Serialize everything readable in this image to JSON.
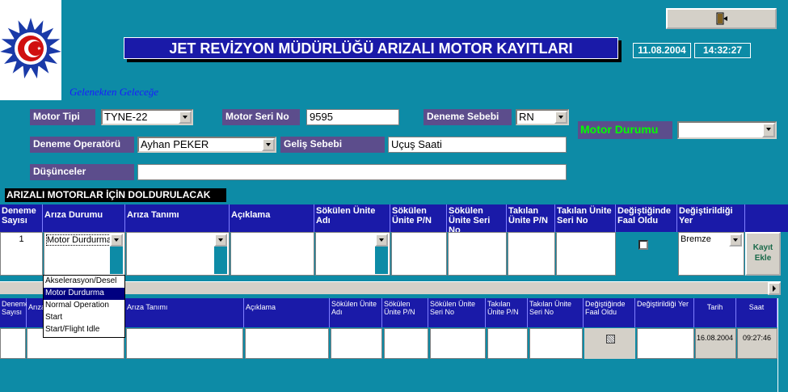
{
  "title": "JET REVİZYON MÜDÜRLÜĞÜ ARIZALI MOTOR KAYITLARI",
  "date": "11.08.2004",
  "time": "14:32:27",
  "slogan": "Gelenekten Geleceğe",
  "form": {
    "motor_tipi_label": "Motor Tipi",
    "motor_tipi_value": "TYNE-22",
    "motor_seri_label": "Motor Seri No",
    "motor_seri_value": "9595",
    "deneme_sebebi_label": "Deneme Sebebi",
    "deneme_sebebi_value": "RN",
    "motor_durumu_label": "Motor Durumu",
    "motor_durumu_value": "",
    "operator_label": "Deneme Operatörü",
    "operator_value": "Ayhan PEKER",
    "gelis_label": "Geliş Sebebi",
    "gelis_value": "Uçuş Saati",
    "dusunceler_label": "Düşünceler",
    "dusunceler_value": ""
  },
  "section_title": "ARIZALI MOTORLAR İÇİN DOLDURULACAK",
  "entry_headers": [
    "Deneme Sayısı",
    "Arıza Durumu",
    "Arıza Tanımı",
    "Açıklama",
    "Sökülen Ünite Adı",
    "Sökülen Ünite P/N",
    "Sökülen Ünite Seri No",
    "Takılan Ünite P/N",
    "Takılan Ünite Seri No",
    "Değiştiğinde Faal Oldu",
    "Değiştirildiği Yer"
  ],
  "entry_row": {
    "deneme": "1",
    "ariza_durumu": "Motor Durdurma",
    "degistirildigi_yer": "Bremze"
  },
  "kayit_button": "Kayıt Ekle",
  "dropdown_options": [
    "Akselerasyon/Desel",
    "Motor Durdurma",
    "Normal Operation",
    "Start",
    "Start/Flight Idle"
  ],
  "dropdown_selected": 1,
  "list_headers": [
    "Deneme Sayısı",
    "Arıza",
    "Arıza Tanımı",
    "Açıklama",
    "Sökülen Ünite Adı",
    "Sökülen Ünite P/N",
    "Sökülen Ünite Seri No",
    "Takılan Ünite P/N",
    "Takılan Ünite Seri No",
    "Değiştiğinde Faal Oldu",
    "Değiştirildiği Yer",
    "Tarih",
    "Saat"
  ],
  "list_row": {
    "tarih": "16.08.2004",
    "saat": "09:27:46"
  }
}
